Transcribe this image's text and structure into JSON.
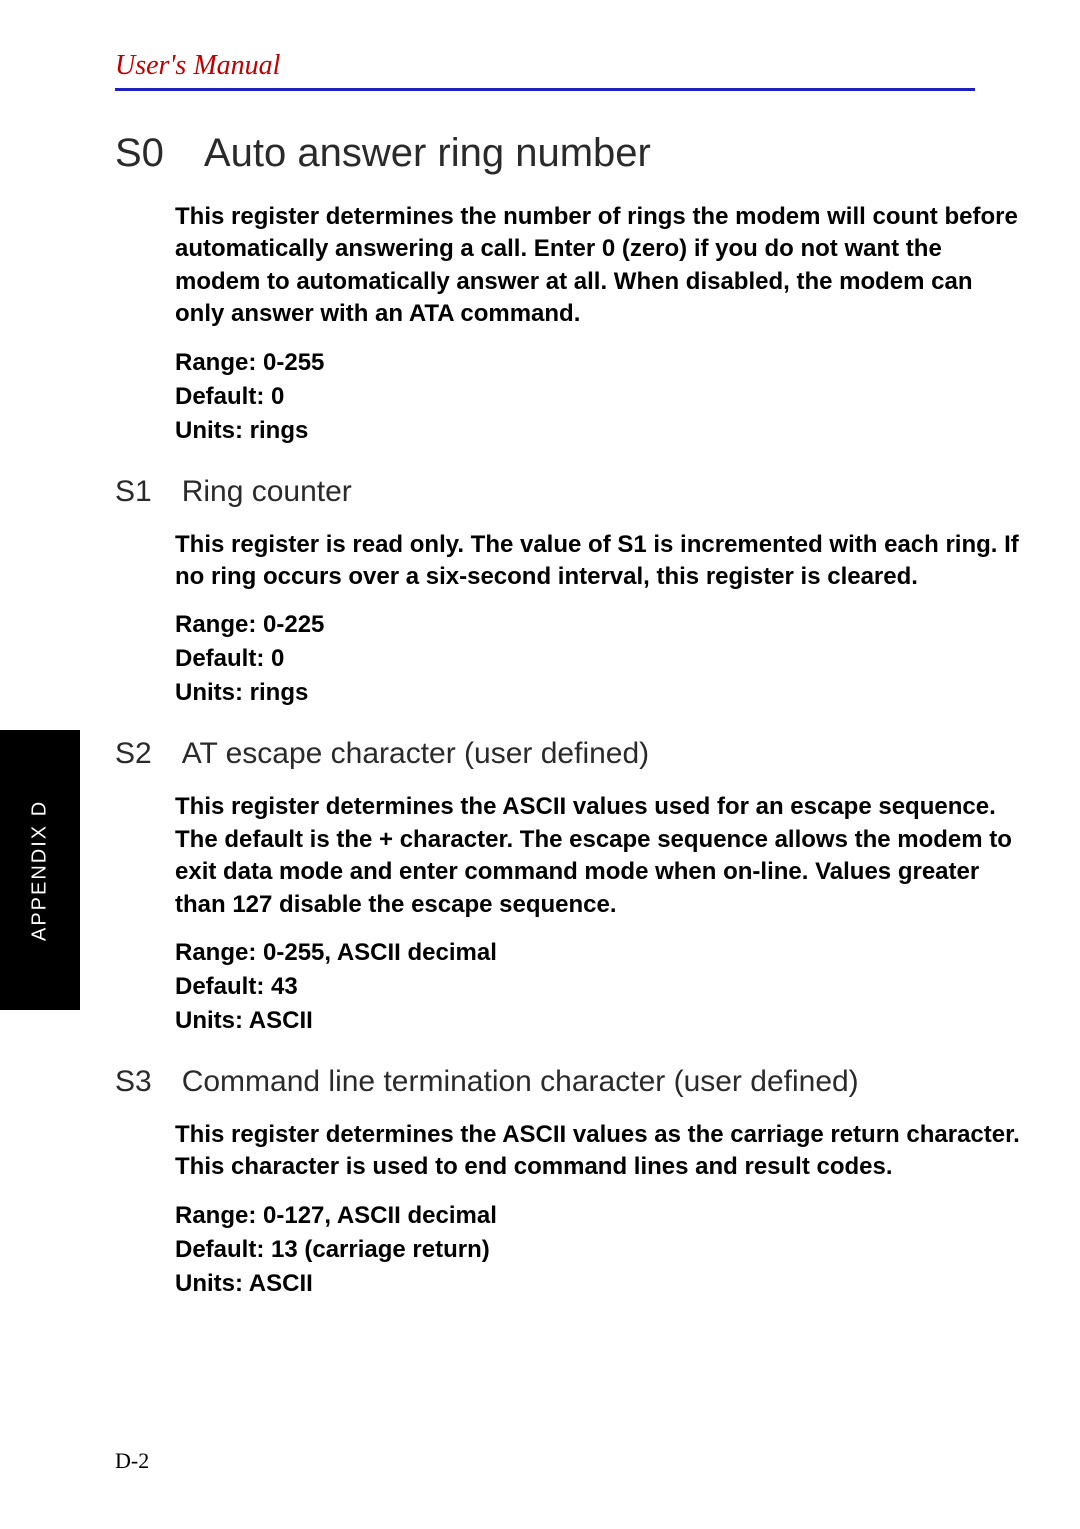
{
  "header": "User's Manual",
  "appendix_label": "APPENDIX D",
  "s0": {
    "heading": "S0 Auto answer ring number",
    "desc": "This register determines the number of rings the modem will count before automatically answering a call. Enter 0 (zero) if you do not want the modem to automatically answer at all. When disabled, the modem can only answer with an ATA command.",
    "range": "Range: 0-255",
    "default": "Default:  0",
    "units": "Units:   rings"
  },
  "s1": {
    "heading": "S1 Ring counter",
    "desc": "This register is read only. The value of S1 is incremented with each ring. If no ring occurs over a six-second interval, this register is cleared.",
    "range": "Range: 0-225",
    "default": "Default:  0",
    "units": "Units:   rings"
  },
  "s2": {
    "heading": "S2 AT escape character (user defined)",
    "desc": "This register determines the ASCII values used for an escape sequence. The default is the + character. The escape sequence allows the modem to exit data mode and enter command mode when on-line. Values greater than 127 disable the escape sequence.",
    "range": "Range: 0-255, ASCII decimal",
    "default": "Default:  43",
    "units": "Units:    ASCII"
  },
  "s3": {
    "heading": "S3 Command line termination character (user defined)",
    "desc": "This register determines the ASCII values as the carriage return character. This character is used to end command lines and result codes.",
    "range": "Range: 0-127, ASCII decimal",
    "default": "Default:  13 (carriage return)",
    "units": "Units:    ASCII"
  },
  "page_number": "D-2"
}
